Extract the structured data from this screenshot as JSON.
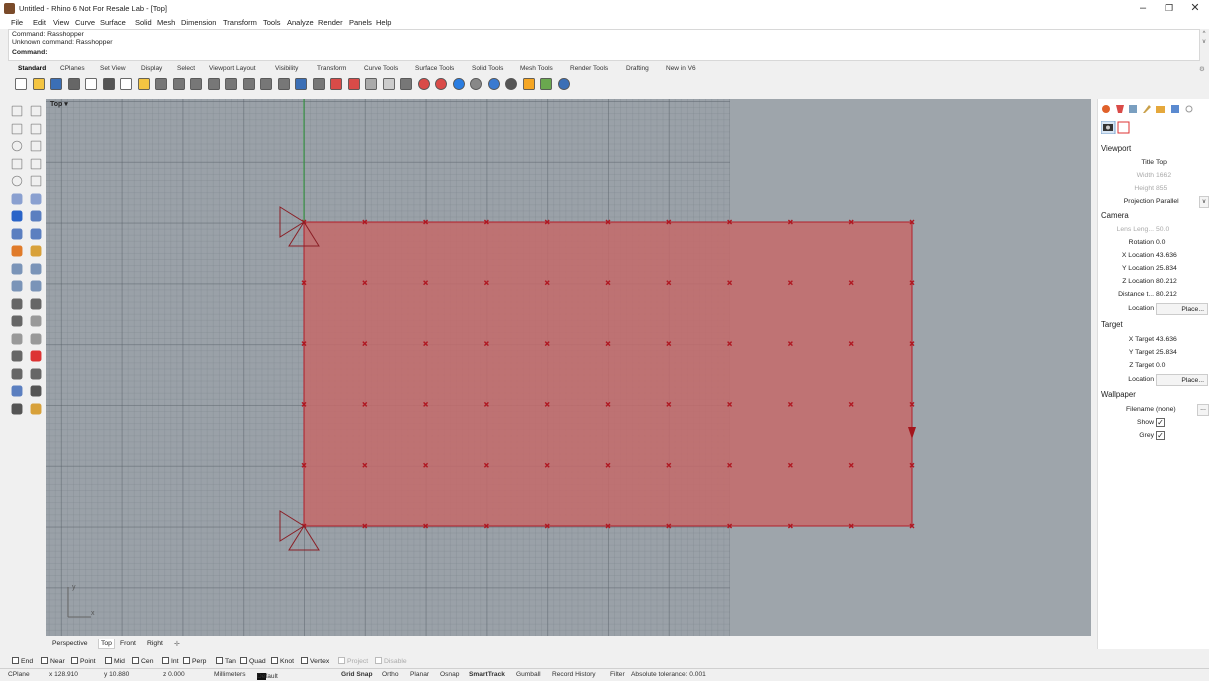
{
  "window": {
    "title": "Untitled - Rhino 6 Not For Resale Lab - [Top]",
    "min_label": "–",
    "max_label": "❐",
    "close_label": "✕"
  },
  "menu": [
    "File",
    "Edit",
    "View",
    "Curve",
    "Surface",
    "Solid",
    "Mesh",
    "Dimension",
    "Transform",
    "Tools",
    "Analyze",
    "Render",
    "Panels",
    "Help"
  ],
  "command": {
    "history": [
      "Command: Rasshopper",
      "Unknown command: Rasshopper"
    ],
    "prompt": "Command:"
  },
  "toolbar_tabs": [
    "Standard",
    "CPlanes",
    "Set View",
    "Display",
    "Select",
    "Viewport Layout",
    "Visibility",
    "Transform",
    "Curve Tools",
    "Surface Tools",
    "Solid Tools",
    "Mesh Tools",
    "Render Tools",
    "Drafting",
    "New in V6"
  ],
  "toolbar_icons": [
    "new-icon",
    "open-icon",
    "save-icon",
    "print-icon",
    "import-icon",
    "cut-icon",
    "copy-icon",
    "paste-icon",
    "undo-icon",
    "pan-icon",
    "rotate-view-icon",
    "zoom-icon",
    "zoom-window-icon",
    "zoom-extents-icon",
    "zoom-selected-icon",
    "four-views-icon",
    "grid-icon",
    "plane-icon",
    "shade-icon",
    "rendered-icon",
    "ghosted-icon",
    "light-icon",
    "lock-icon",
    "layer-icon",
    "material-icon",
    "sphere-icon",
    "env-icon",
    "render-icon",
    "sun-icon",
    "mesh-icon",
    "grasshopper-icon",
    "help-icon"
  ],
  "viewport": {
    "name": "Top",
    "menu_arrow": "▾",
    "axis_x": "x",
    "axis_y": "y",
    "surface_color": "#c46a6a",
    "surface_edge": "#b21f2a",
    "point_color": "#b01822"
  },
  "view_tabs": [
    "Perspective",
    "Top",
    "Front",
    "Right"
  ],
  "view_tab_add": "✛",
  "osnaps": [
    {
      "label": "End",
      "checked": false,
      "enabled": true
    },
    {
      "label": "Near",
      "checked": false,
      "enabled": true
    },
    {
      "label": "Point",
      "checked": false,
      "enabled": true
    },
    {
      "label": "Mid",
      "checked": false,
      "enabled": true
    },
    {
      "label": "Cen",
      "checked": false,
      "enabled": true
    },
    {
      "label": "Int",
      "checked": false,
      "enabled": true
    },
    {
      "label": "Perp",
      "checked": false,
      "enabled": true
    },
    {
      "label": "Tan",
      "checked": false,
      "enabled": true
    },
    {
      "label": "Quad",
      "checked": false,
      "enabled": true
    },
    {
      "label": "Knot",
      "checked": false,
      "enabled": true
    },
    {
      "label": "Vertex",
      "checked": false,
      "enabled": true
    },
    {
      "label": "Project",
      "checked": false,
      "enabled": false
    },
    {
      "label": "Disable",
      "checked": false,
      "enabled": false
    }
  ],
  "status": {
    "cplane": "CPlane",
    "x": "x 128.910",
    "y": "y 10.880",
    "z": "z 0.000",
    "units": "Millimeters",
    "layer": "Default",
    "grid_snap": "Grid Snap",
    "ortho": "Ortho",
    "planar": "Planar",
    "osnap": "Osnap",
    "smarttrack": "SmartTrack",
    "gumball": "Gumball",
    "record_history": "Record History",
    "filter": "Filter",
    "tolerance": "Absolute tolerance: 0.001"
  },
  "panel": {
    "viewport_header": "Viewport",
    "title_label": "Title",
    "title_value": "Top",
    "width_label": "Width",
    "width_value": "1662",
    "height_label": "Height",
    "height_value": "855",
    "projection_label": "Projection",
    "projection_value": "Parallel",
    "camera_header": "Camera",
    "lens_label": "Lens Leng...",
    "lens_value": "50.0",
    "rotation_label": "Rotation",
    "rotation_value": "0.0",
    "xloc_label": "X Location",
    "xloc_value": "43.636",
    "yloc_label": "Y Location",
    "yloc_value": "25.834",
    "zloc_label": "Z Location",
    "zloc_value": "80.212",
    "dist_label": "Distance t...",
    "dist_value": "80.212",
    "loc_label": "Location",
    "place_label": "Place...",
    "target_header": "Target",
    "xt_label": "X Target",
    "xt_value": "43.636",
    "yt_label": "Y Target",
    "yt_value": "25.834",
    "zt_label": "Z Target",
    "zt_value": "0.0",
    "tloc_label": "Location",
    "tplace_label": "Place...",
    "wallpaper_header": "Wallpaper",
    "filename_label": "Filename",
    "filename_value": "(none)",
    "show_label": "Show",
    "show_checked": true,
    "grey_label": "Grey",
    "grey_checked": true,
    "dropdown_arrow": "v",
    "ellipsis": "...",
    "check_mark": "✓"
  }
}
